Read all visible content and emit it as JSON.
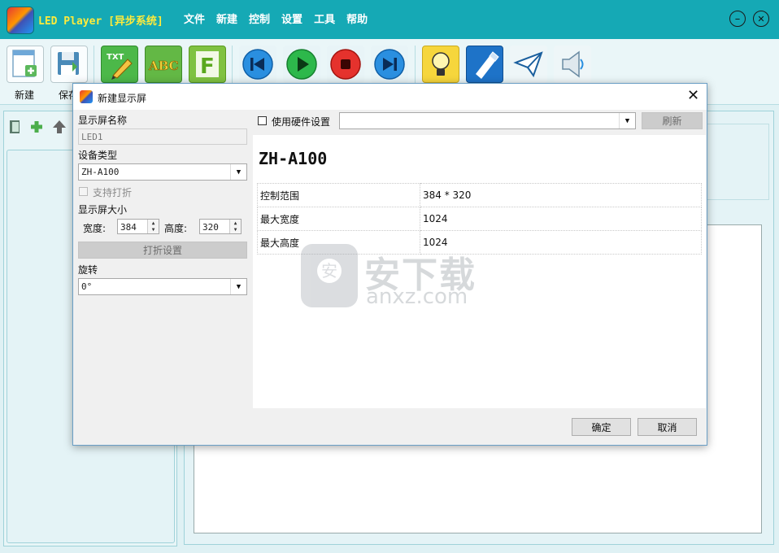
{
  "app": {
    "title": "LED Player [异步系统]",
    "menu": [
      "文件",
      "新建",
      "控制",
      "设置",
      "工具",
      "帮助"
    ],
    "minimize_glyph": "–",
    "close_glyph": "✕"
  },
  "toolbar": {
    "new_label": "新建",
    "save_label": "保存"
  },
  "dialog": {
    "title": "新建显示屏",
    "close_glyph": "✕",
    "screen_name_label": "显示屏名称",
    "screen_name_value": "LED1",
    "device_type_label": "设备类型",
    "device_type_value": "ZH-A100",
    "support_fold_label": "支持打折",
    "size_label": "显示屏大小",
    "width_label": "宽度:",
    "width_value": "384",
    "height_label": "高度:",
    "height_value": "320",
    "fold_settings_button": "打折设置",
    "rotation_label": "旋转",
    "rotation_value": "0°",
    "use_hardware_label": "使用硬件设置",
    "refresh_button": "刷新",
    "device_heading": "ZH-A100",
    "specs": [
      {
        "name": "控制范围",
        "value": "384 * 320"
      },
      {
        "name": "最大宽度",
        "value": "1024"
      },
      {
        "name": "最大高度",
        "value": "1024"
      }
    ],
    "ok_button": "确定",
    "cancel_button": "取消"
  },
  "watermark": {
    "line1": "安下载",
    "line2": "anxz.com",
    "shield_char": "安"
  }
}
